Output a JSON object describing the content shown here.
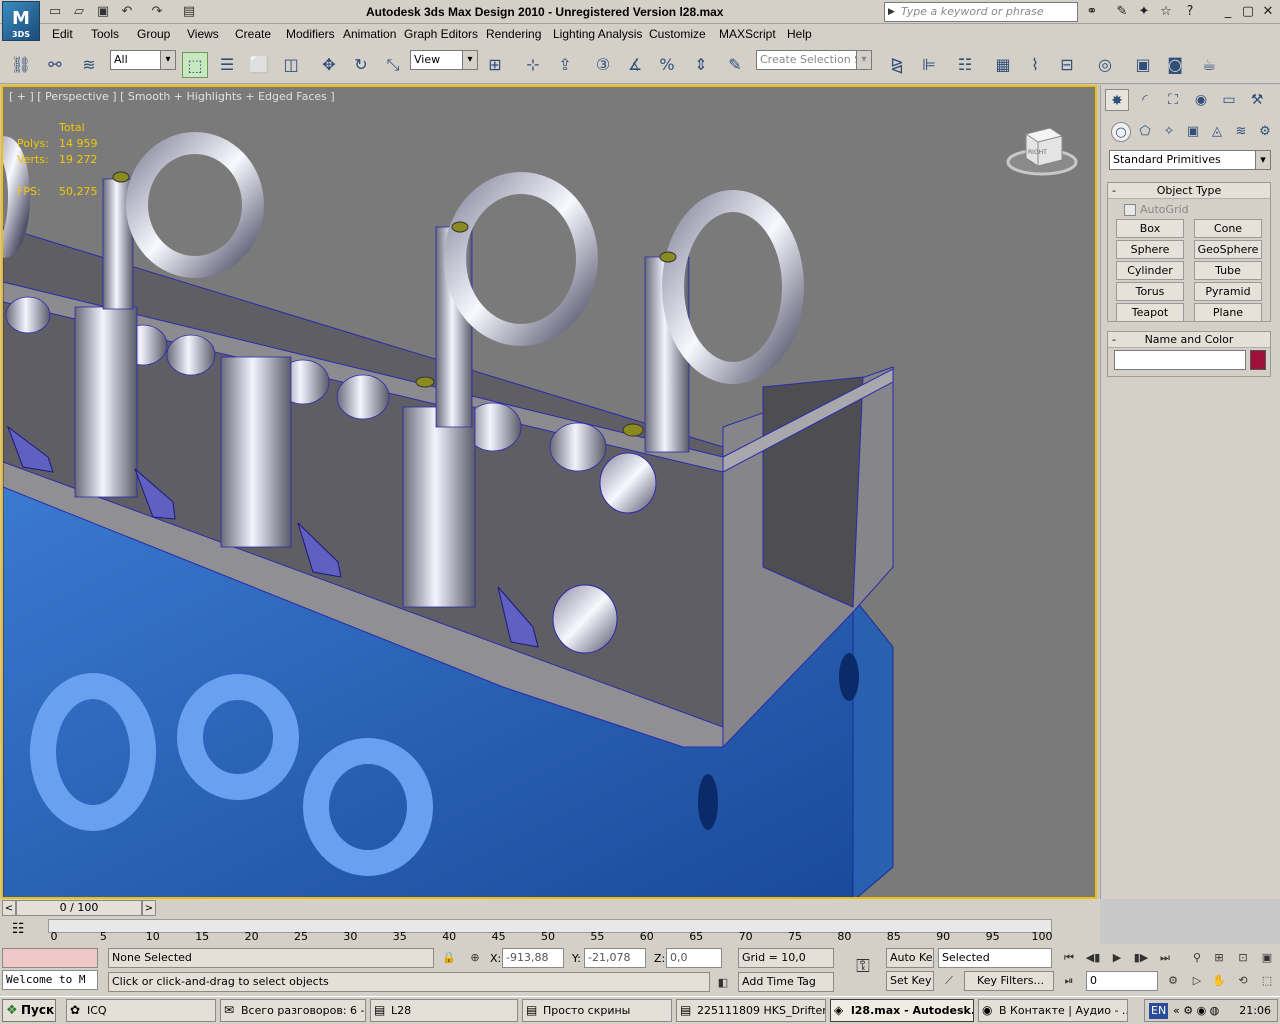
{
  "window": {
    "title": "Autodesk 3ds Max Design 2010    - Unregistered Version     l28.max",
    "logo_text": "3DS",
    "search_placeholder": "Type a keyword or phrase"
  },
  "menu": [
    "Edit",
    "Tools",
    "Group",
    "Views",
    "Create",
    "Modifiers",
    "Animation",
    "Graph Editors",
    "Rendering",
    "Lighting Analysis",
    "Customize",
    "MAXScript",
    "Help"
  ],
  "toolbar": {
    "filter_value": "All",
    "ref_coord_value": "View",
    "selection_set_placeholder": "Create Selection Se"
  },
  "viewport": {
    "label": "[ + ] [ Perspective ] [ Smooth + Highlights + Edged Faces ]",
    "stats": {
      "header": "Total",
      "polys_label": "Polys:",
      "polys_value": "14 959",
      "verts_label": "Verts:",
      "verts_value": "19 272",
      "fps_label": "FPS:",
      "fps_value": "50,275"
    },
    "viewcube_label": "RIGHT"
  },
  "command_panel": {
    "category": "Standard Primitives",
    "object_type_title": "Object Type",
    "autogrid_label": "AutoGrid",
    "primitives": [
      "Box",
      "Cone",
      "Sphere",
      "GeoSphere",
      "Cylinder",
      "Tube",
      "Torus",
      "Pyramid",
      "Teapot",
      "Plane"
    ],
    "name_color_title": "Name and Color",
    "swatch_color": "#a0103a"
  },
  "time": {
    "slider_label": "0 / 100",
    "ticks": [
      "0",
      "5",
      "10",
      "15",
      "20",
      "25",
      "30",
      "35",
      "40",
      "45",
      "50",
      "55",
      "60",
      "65",
      "70",
      "75",
      "80",
      "85",
      "90",
      "95",
      "100"
    ]
  },
  "status": {
    "maxscript_listener": "Welcome to M",
    "selection_status": "None Selected",
    "prompt": "Click or click-and-drag to select objects",
    "x_label": "X:",
    "x_value": "-913,88",
    "y_label": "Y:",
    "y_value": "-21,078",
    "z_label": "Z:",
    "z_value": "0,0",
    "grid": "Grid = 10,0",
    "add_time_tag": "Add Time Tag",
    "auto_key": "Auto Key",
    "set_key": "Set Key",
    "key_mode": "Selected",
    "key_filters": "Key Filters...",
    "frame": "0"
  },
  "taskbar": {
    "start": "Пуск",
    "tasks": [
      {
        "label": "ICQ",
        "icon": "✿"
      },
      {
        "label": "Всего разговоров: 6 -...",
        "icon": "✉"
      },
      {
        "label": "L28",
        "icon": "▤"
      },
      {
        "label": "Просто скрины",
        "icon": "▤"
      },
      {
        "label": "225111809 HKS_Drifter",
        "icon": "▤"
      },
      {
        "label": "l28.max - Autodesk...",
        "icon": "◈"
      },
      {
        "label": "В Контакте | Аудио - ...",
        "icon": "◉"
      }
    ],
    "lang": "EN",
    "clock": "21:06"
  }
}
